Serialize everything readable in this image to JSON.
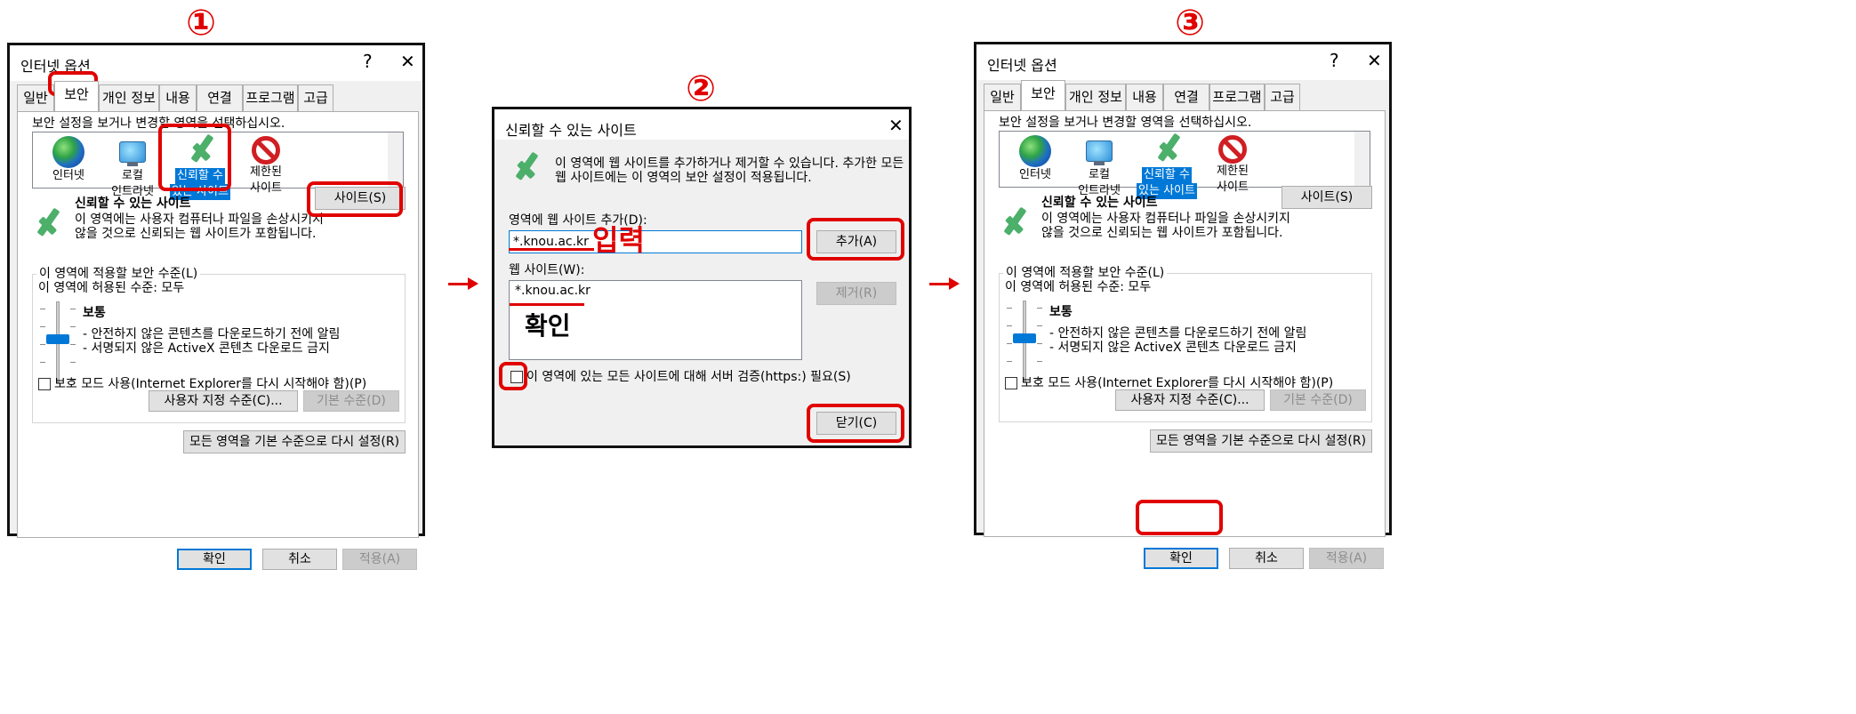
{
  "steps": [
    "①",
    "②",
    "③"
  ],
  "colors": {
    "accent": "#0078d7",
    "annotation_red": "#e00000",
    "check_green": "#4caf6a"
  },
  "internet_options": {
    "title": "인터넷 옵션",
    "help_glyph": "?",
    "close_glyph": "✕",
    "tabs": [
      "일반",
      "보안",
      "개인 정보",
      "내용",
      "연결",
      "프로그램",
      "고급"
    ],
    "active_tab": "보안",
    "zone_prompt": "보안 설정을 보거나 변경할 영역을 선택하십시오.",
    "zones": [
      {
        "icon": "globe-icon",
        "label_line1": "인터넷",
        "label_line2": ""
      },
      {
        "icon": "local-intranet-icon",
        "label_line1": "로컬",
        "label_line2": "인트라넷"
      },
      {
        "icon": "trusted-sites-check-icon",
        "label_line1": "신뢰할 수",
        "label_line2": "있는 사이트"
      },
      {
        "icon": "restricted-sites-icon",
        "label_line1": "제한된",
        "label_line2": "사이트"
      }
    ],
    "selected_zone": "신뢰할 수 있는 사이트",
    "zone_title": "신뢰할 수 있는 사이트",
    "zone_desc_line1": "이 영역에는 사용자 컴퓨터나 파일을 손상시키지",
    "zone_desc_line2": "않을 것으로 신뢰되는 웹 사이트가 포함됩니다.",
    "sites_button": "사이트(S)",
    "security_level_group": "이 영역에 적용할 보안 수준(L)",
    "allowed_levels": "이 영역에 허용된 수준: 모두",
    "level_name": "보통",
    "level_desc_1": "- 안전하지 않은 콘텐츠를 다운로드하기 전에 알림",
    "level_desc_2": "- 서명되지 않은 ActiveX 콘텐츠 다운로드 금지",
    "protected_mode": "보호 모드 사용(Internet Explorer를 다시 시작해야 함)(P)",
    "protected_mode_checked": false,
    "custom_level_button": "사용자 지정 수준(C)...",
    "default_level_button": "기본 수준(D)",
    "reset_all_button": "모든 영역을 기본 수준으로 다시 설정(R)",
    "ok_button": "확인",
    "cancel_button": "취소",
    "apply_button": "적용(A)"
  },
  "trusted_sites_dialog": {
    "title": "신뢰할 수 있는 사이트",
    "close_glyph": "✕",
    "info_line1": "이 영역에 웹 사이트를 추가하거나 제거할 수 있습니다. 추가한 모든",
    "info_line2": "웹 사이트에는 이 영역의 보안 설정이 적용됩니다.",
    "add_label": "영역에 웹 사이트 추가(D):",
    "add_input_value": "*.knou.ac.kr",
    "add_button": "추가(A)",
    "websites_label": "웹 사이트(W):",
    "websites": [
      "*.knou.ac.kr"
    ],
    "remove_button": "제거(R)",
    "https_checkbox": "이 영역에 있는 모든 사이트에 대해 서버 검증(https:) 필요(S)",
    "https_checked": false,
    "close_button": "닫기(C)"
  },
  "annotations": {
    "input_note": "입력",
    "confirm_note": "확인"
  }
}
